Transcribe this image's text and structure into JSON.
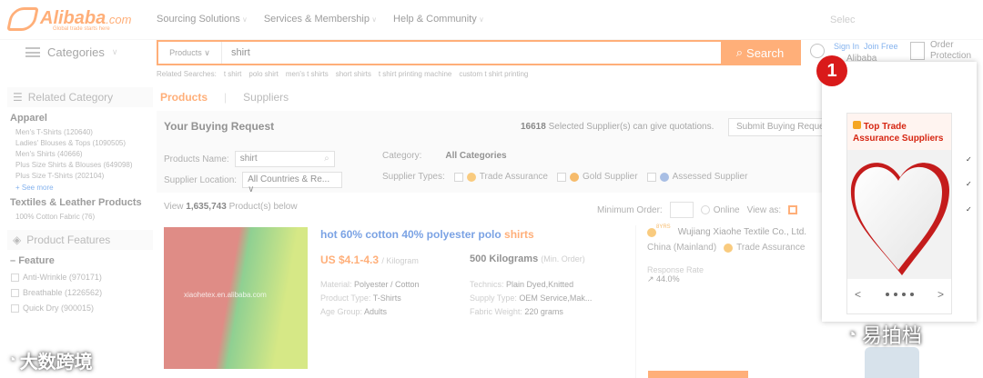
{
  "header": {
    "logo_text": "Alibaba",
    "logo_domain": ".com",
    "logo_tagline": "Global trade starts here",
    "nav": [
      "Sourcing Solutions",
      "Services & Membership",
      "Help & Community"
    ],
    "select_label": "Selec"
  },
  "categories_label": "Categories",
  "search": {
    "type_label": "Products",
    "value": "shirt",
    "button_label": "Search",
    "related_label": "Related Searches:",
    "related": [
      "t shirt",
      "polo shirt",
      "men's t shirts",
      "short shirts",
      "t shirt printing machine",
      "custom t shirt printing"
    ]
  },
  "account": {
    "sign_in": "Sign In",
    "join_free": "Join Free",
    "alibaba": "Alibaba",
    "order_protection": "Order Protection"
  },
  "sidebar": {
    "related_category_title": "Related Category",
    "group1": "Apparel",
    "group1_items": [
      "Men's T-Shirts (120640)",
      "Ladies' Blouses & Tops (1090505)",
      "Men's Shirts (40666)",
      "Plus Size Shirts & Blouses (649098)",
      "Plus Size T-Shirts (202104)"
    ],
    "see_more": "+ See more",
    "group2": "Textiles & Leather Products",
    "group2_items": [
      "100% Cotton Fabric (76)"
    ],
    "features_title": "Product Features",
    "feature_group": "Feature",
    "features": [
      "Anti-Wrinkle (970171)",
      "Breathable (1226562)",
      "Quick Dry (900015)"
    ]
  },
  "main": {
    "tabs": [
      "Products",
      "Suppliers"
    ],
    "buying_title": "Your Buying Request",
    "suppliers_count": "16618",
    "suppliers_text": "Selected Supplier(s) can give quotations.",
    "submit_label": "Submit Buying Request",
    "product_name_label": "Products Name:",
    "product_name_value": "shirt",
    "category_label": "Category:",
    "category_value": "All Categories",
    "supplier_location_label": "Supplier Location:",
    "supplier_location_value": "All Countries & Re...",
    "supplier_types_label": "Supplier Types:",
    "supplier_types": [
      "Trade Assurance",
      "Gold Supplier",
      "Assessed Supplier"
    ],
    "view_prefix": "View",
    "view_count": "1,635,743",
    "view_suffix": "Product(s) below",
    "min_order_label": "Minimum Order:",
    "online_label": "Online",
    "view_as_label": "View as:"
  },
  "product": {
    "title_prefix": "hot 60% cotton 40% polyester polo ",
    "title_highlight": "shirts",
    "price": "US $4.1-4.3",
    "price_unit": "/ Kilogram",
    "moq": "500 Kilograms",
    "moq_note": "(Min. Order)",
    "material_label": "Material:",
    "material": "Polyester / Cotton",
    "type_label": "Product Type:",
    "type": "T-Shirts",
    "age_label": "Age Group:",
    "age": "Adults",
    "technics_label": "Technics:",
    "technics": "Plain Dyed,Knitted",
    "supply_label": "Supply Type:",
    "supply": "OEM Service,Mak...",
    "weight_label": "Fabric Weight:",
    "weight": "220 grams",
    "image_watermark": "xiaohetex.en.alibaba.com"
  },
  "supplier": {
    "years": "8YRS",
    "name": "Wujiang Xiaohe Textile Co., Ltd.",
    "location": "China (Mainland)",
    "trade_assurance": "Trade Assurance",
    "response_label": "Response Rate",
    "response_value": "44.0%"
  },
  "panel": {
    "title": "Top Trade Assurance Suppliers",
    "prev": "<",
    "next": ">"
  },
  "marker_number": "1",
  "watermarks": {
    "left": "大数跨境",
    "right": "易拍档"
  },
  "colors": {
    "accent": "#ff7519",
    "link": "#2a7ae2",
    "marker": "#d91a1a"
  }
}
